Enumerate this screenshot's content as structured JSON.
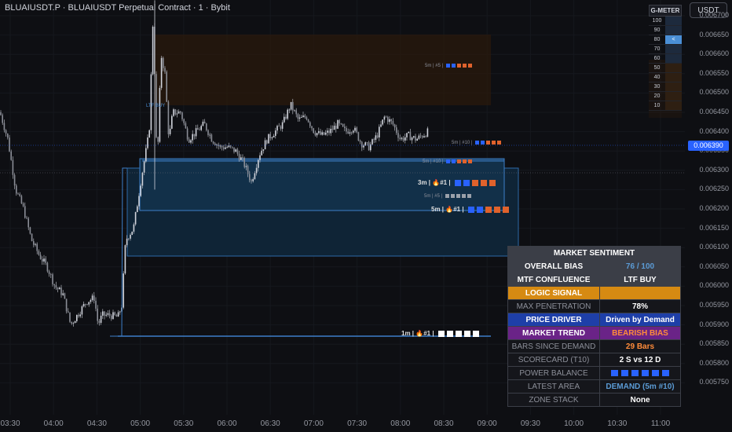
{
  "header": {
    "title": "BLUAIUSDT.P · BLUAIUSDT Perpetual Contract · 1 · Bybit",
    "currency": "USDT"
  },
  "price_axis": {
    "labels": [
      "0.006700",
      "0.006650",
      "0.006600",
      "0.006550",
      "0.006500",
      "0.006450",
      "0.006400",
      "0.006350",
      "0.006300",
      "0.006250",
      "0.006200",
      "0.006150",
      "0.006100",
      "0.006050",
      "0.006000",
      "0.005950",
      "0.005900",
      "0.005850",
      "0.005800",
      "0.005750"
    ],
    "current": "0.006390"
  },
  "time_axis": {
    "labels": [
      "03:30",
      "04:00",
      "04:30",
      "05:00",
      "05:30",
      "06:00",
      "06:30",
      "07:00",
      "07:30",
      "08:00",
      "08:30",
      "09:00",
      "09:30",
      "10:00",
      "10:30",
      "11:00"
    ]
  },
  "gmeter": {
    "title": "G-METER",
    "levels": [
      "100",
      "90",
      "80",
      "70",
      "60",
      "50",
      "40",
      "30",
      "20",
      "10"
    ],
    "pointer": "<",
    "active_level": 80
  },
  "chart_labels": {
    "ltf_buy": "LTF BUY"
  },
  "zones": [
    {
      "label": "5m | #5 |",
      "dots": [
        "#2962ff",
        "#2962ff",
        "#e0622c",
        "#e0622c",
        "#e0622c"
      ]
    },
    {
      "label": "5m | #10 |",
      "dots": [
        "#2962ff",
        "#2962ff",
        "#e0622c",
        "#e0622c",
        "#e0622c"
      ]
    },
    {
      "label": "5m | #10 |",
      "dots": [
        "#2962ff",
        "#2962ff",
        "#e0622c",
        "#e0622c",
        "#e0622c"
      ]
    },
    {
      "label": "3m | 🔥#1 |",
      "dots": [
        "#2962ff",
        "#2962ff",
        "#e0622c",
        "#e0622c",
        "#e0622c"
      ]
    },
    {
      "label": "5m | #5 |",
      "dots": [
        "#9aa0aa",
        "#9aa0aa",
        "#9aa0aa",
        "#9aa0aa",
        "#9aa0aa"
      ]
    },
    {
      "label": "5m | 🔥#1 |",
      "dots": [
        "#2962ff",
        "#2962ff",
        "#e0622c",
        "#e0622c",
        "#e0622c"
      ]
    },
    {
      "label": "1m | 🔥#1 |",
      "dots": [
        "#ffffff",
        "#ffffff",
        "#ffffff",
        "#ffffff",
        "#ffffff"
      ]
    }
  ],
  "sentiment": {
    "title": "MARKET SENTIMENT",
    "rows": [
      {
        "label": "OVERALL BIAS",
        "value": "76 / 100",
        "lbg": "#3b3e47",
        "vbg": "#3b3e47",
        "lc": "#ffffff",
        "vc": "#5b9bd5",
        "lb": true
      },
      {
        "label": "MTF CONFLUENCE",
        "value": "LTF BUY",
        "lbg": "#3b3e47",
        "vbg": "#3b3e47",
        "lc": "#ffffff",
        "vc": "#ffffff",
        "lb": true
      },
      {
        "label": "LOGIC SIGNAL",
        "value": "",
        "lbg": "#d68a12",
        "vbg": "#d68a12",
        "lc": "#ffffff",
        "vc": "#ffffff",
        "lb": true
      },
      {
        "label": "MAX PENETRATION",
        "value": "78%",
        "lbg": "#15161b",
        "vbg": "#15161b",
        "lc": "#8c8f99",
        "vc": "#ffffff",
        "lb": false
      },
      {
        "label": "PRICE DRIVER",
        "value": "Driven by Demand",
        "lbg": "#1e3fa8",
        "vbg": "#1e3fa8",
        "lc": "#ffffff",
        "vc": "#ffffff",
        "lb": true
      },
      {
        "label": "MARKET TREND",
        "value": "BEARISH BIAS",
        "lbg": "#6a2387",
        "vbg": "#6a2387",
        "lc": "#ffffff",
        "vc": "#ff8c3a",
        "lb": true
      },
      {
        "label": "BARS SINCE DEMAND",
        "value": "29 Bars",
        "lbg": "#15161b",
        "vbg": "#15161b",
        "lc": "#8c8f99",
        "vc": "#ff8c3a",
        "lb": false
      },
      {
        "label": "SCORECARD (T10)",
        "value": "2 S vs 12 D",
        "lbg": "#15161b",
        "vbg": "#15161b",
        "lc": "#8c8f99",
        "vc": "#ffffff",
        "lb": false
      },
      {
        "label": "POWER BALANCE",
        "value": "",
        "lbg": "#15161b",
        "vbg": "#15161b",
        "lc": "#8c8f99",
        "vc": "#2962ff",
        "lb": false,
        "dots": true
      },
      {
        "label": "LATEST AREA",
        "value": "DEMAND (5m #10)",
        "lbg": "#15161b",
        "vbg": "#15161b",
        "lc": "#8c8f99",
        "vc": "#5b9bd5",
        "lb": false
      },
      {
        "label": "ZONE STACK",
        "value": "None",
        "lbg": "#15161b",
        "vbg": "#15161b",
        "lc": "#8c8f99",
        "vc": "#ffffff",
        "lb": false
      }
    ]
  },
  "colors": {
    "bg": "#0e0f13",
    "candle": "#d1d4dc",
    "demand": "#3d7fc9",
    "supply": "#7a4a1c",
    "accent": "#2962ff"
  }
}
